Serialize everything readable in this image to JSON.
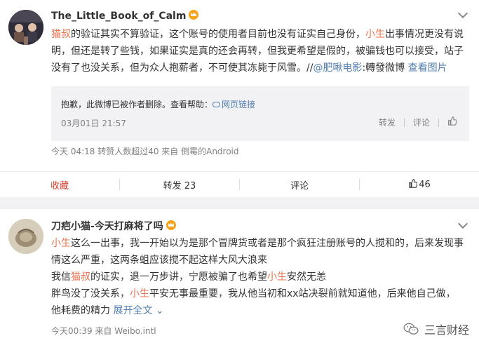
{
  "post1": {
    "username": "The_Little_Book_of_Calm",
    "text_p1": "猫叔",
    "text_p2": "的验证其实不算验证，这个账号的使用者目前也没有证实自己身份，",
    "text_p3": "小生",
    "text_p4": "出事情况更没有说明，但还是转了些钱，如果证实是真的还会再转，但我更希望是假的，被骗钱也可以接受，站子没有了也没关系，但为众人抱薪者，不可使其冻毙于风雪。//",
    "text_p5": "@肥啾电影",
    "text_p6": ":轉發微博 ",
    "text_more": "查看图片",
    "quoted": {
      "notice": "抱歉，此微博已被作者删除。查看帮助：",
      "help_link": "网页链接",
      "date": "03月01日 21:57",
      "repost": "转发",
      "comment": "评论"
    },
    "meta": "今天 04:18 转赞人数超过40 来自 倒霉的Android",
    "actions": {
      "favorite": "收藏",
      "repost": "转发 23",
      "comment": "评论",
      "likes": "46"
    }
  },
  "post2": {
    "username": "刀疤小猫-今天打麻将了吗",
    "line1_a": "小生",
    "line1_b": "这么一出事，我一开始以为是那个冒牌货或者是那个疯狂注册账号的人搅和的，后来发现事情这么严重，这两条蛆应该搅不起这样大风大浪来",
    "line2_a": "我信",
    "line2_b": "猫叔",
    "line2_c": "的证实，退一万步讲，宁愿被骗了也希望",
    "line2_d": "小生",
    "line2_e": "安然无恙",
    "line3_a": "胖鸟没了没关系，",
    "line3_b": "小生",
    "line3_c": "平安无事最重要，我从他当初和xx站决裂前就知道他，后来他自己做，他耗费的精力 ",
    "line3_more": "展开全文",
    "meta": "今天00:39 来自 Weibo.intl"
  },
  "watermark": {
    "text": "三言财经",
    "icon": "wechat-icon"
  },
  "colors": {
    "highlight": "#eb7350",
    "link": "#507daf",
    "favorite": "#d23f2e"
  }
}
